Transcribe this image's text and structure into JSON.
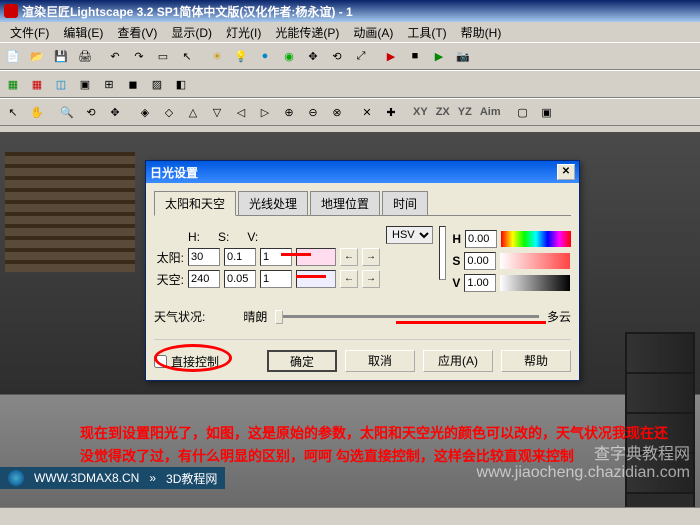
{
  "window": {
    "title": "渲染巨匠Lightscape 3.2 SP1简体中文版(汉化作者:杨永谊) - 1"
  },
  "menu": [
    "文件(F)",
    "编辑(E)",
    "查看(V)",
    "显示(D)",
    "灯光(I)",
    "光能传递(P)",
    "动画(A)",
    "工具(T)",
    "帮助(H)"
  ],
  "toolbar_axis": {
    "xy": "XY",
    "zx": "ZX",
    "yz": "YZ",
    "aim": "Aim"
  },
  "dialog": {
    "title": "日光设置",
    "tabs": [
      "太阳和天空",
      "光线处理",
      "地理位置",
      "时间"
    ],
    "hsv_labels": {
      "h": "H:",
      "s": "S:",
      "v": "V:"
    },
    "hsv_mode": "HSV",
    "big_labels": {
      "h": "H",
      "s": "S",
      "v": "V"
    },
    "big_vals": {
      "h": "0.00",
      "s": "0.00",
      "v": "1.00"
    },
    "sun": {
      "label": "太阳:",
      "h": "30",
      "s": "0.1",
      "v": "1"
    },
    "sky": {
      "label": "天空:",
      "h": "240",
      "s": "0.05",
      "v": "1"
    },
    "weather": {
      "label": "天气状况:",
      "clear": "晴朗",
      "cloudy": "多云"
    },
    "direct": "直接控制",
    "buttons": {
      "ok": "确定",
      "cancel": "取消",
      "apply": "应用(A)",
      "help": "帮助"
    }
  },
  "caption": "现在到设置阳光了，如图，这是原始的参数，太阳和天空光的颜色可以改的，天气状况我现在还没觉得改了过，有什么明显的区别，呵呵  勾选直接控制，这样会比较直观来控制",
  "footer": {
    "url": "WWW.3DMAX8.CN",
    "label": "3D教程网"
  },
  "watermark": "查字典教程网\nwww.jiaocheng.chazidian.com"
}
